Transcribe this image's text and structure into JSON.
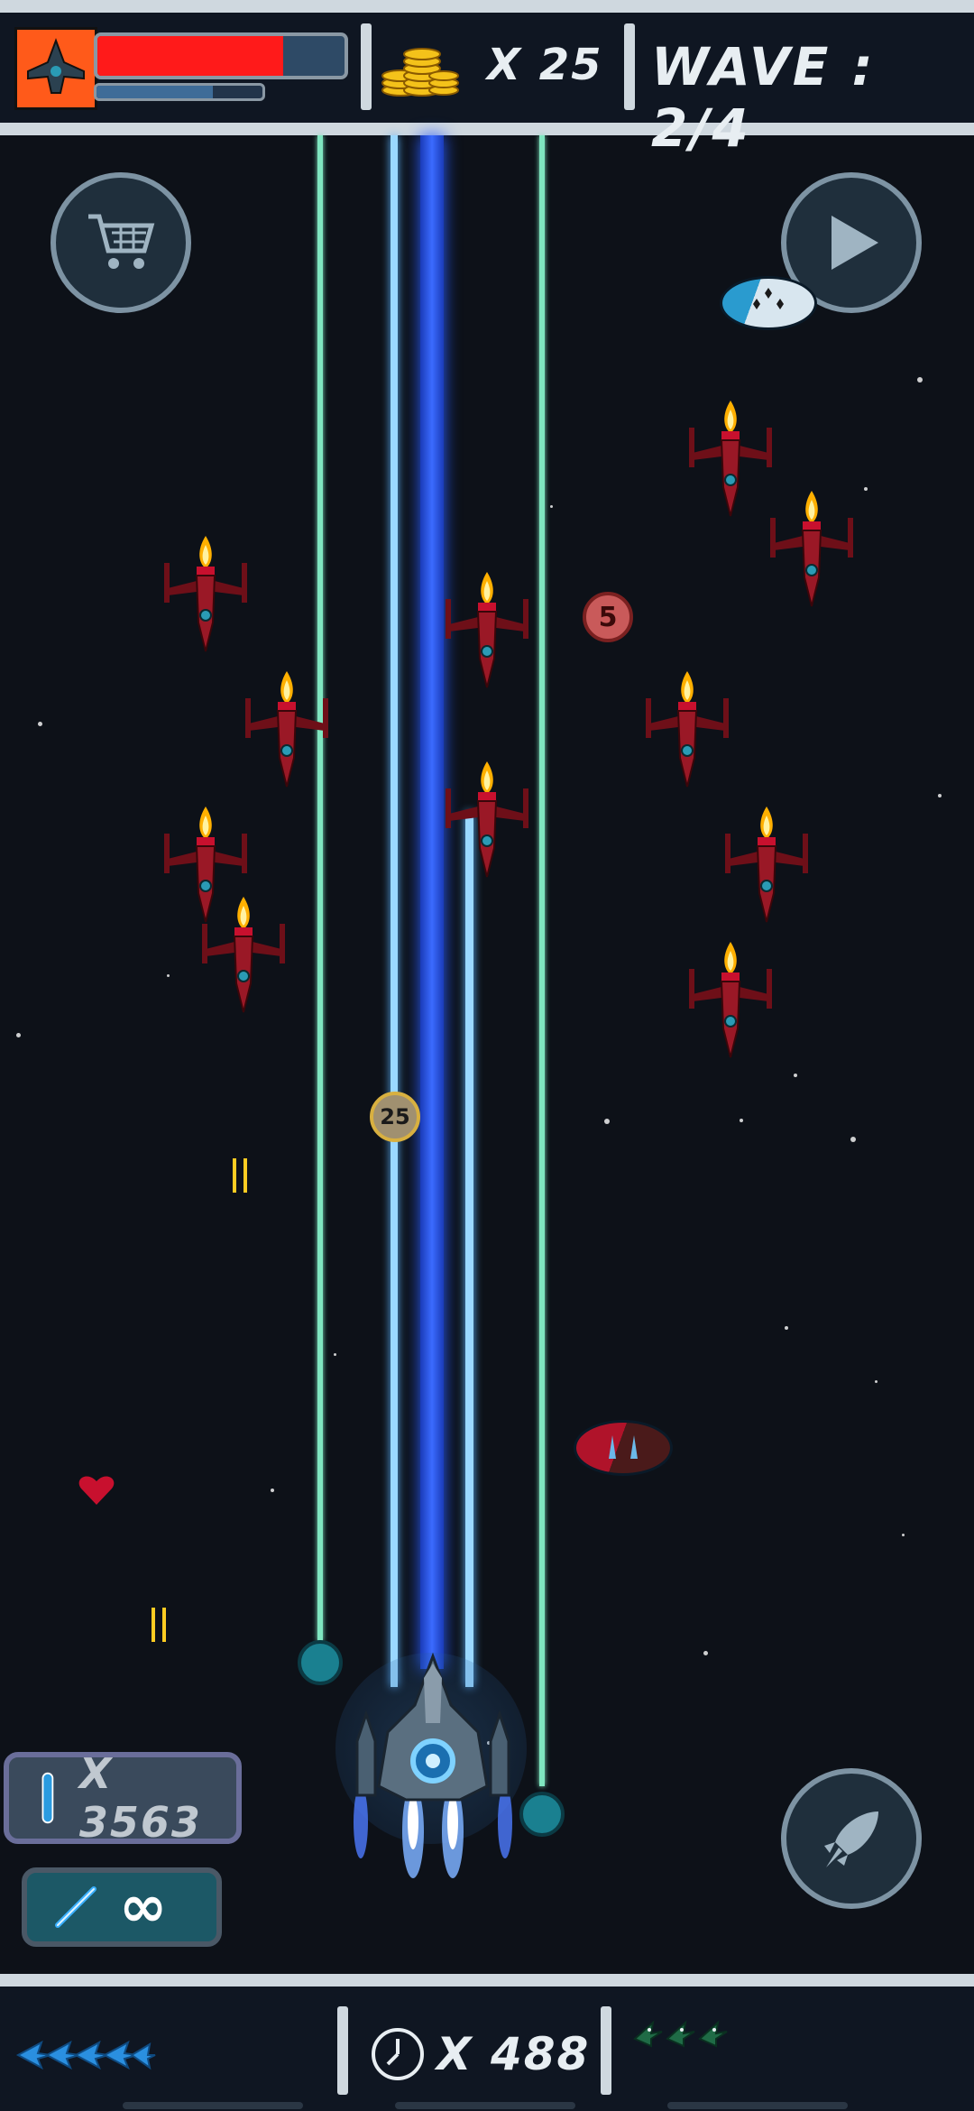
{
  "hud": {
    "health_fraction": 0.75,
    "shield_fraction": 0.7,
    "coin_count": "X 25",
    "wave_label": "WAVE : 2/4"
  },
  "bottom": {
    "timer_value": "X 488"
  },
  "ammo": {
    "missile_count": "X 3563",
    "laser_ammo": "∞"
  },
  "pickups": {
    "coin_small": "5",
    "coin_large": "25"
  },
  "icons": [
    "player-ship-icon",
    "coin-stack-icon",
    "cart-icon",
    "play-icon",
    "rocket-icon",
    "clock-icon",
    "heart-icon",
    "missile-icon",
    "laser-icon"
  ],
  "colors": {
    "health": "#ff1a1a",
    "shield": "#3e6c98",
    "beam_core": "#2350d8",
    "beam_side": "#7fc7ff",
    "laser_green": "#7fe6c0",
    "enemy": "#9a1826",
    "flame": "#ffb000"
  }
}
